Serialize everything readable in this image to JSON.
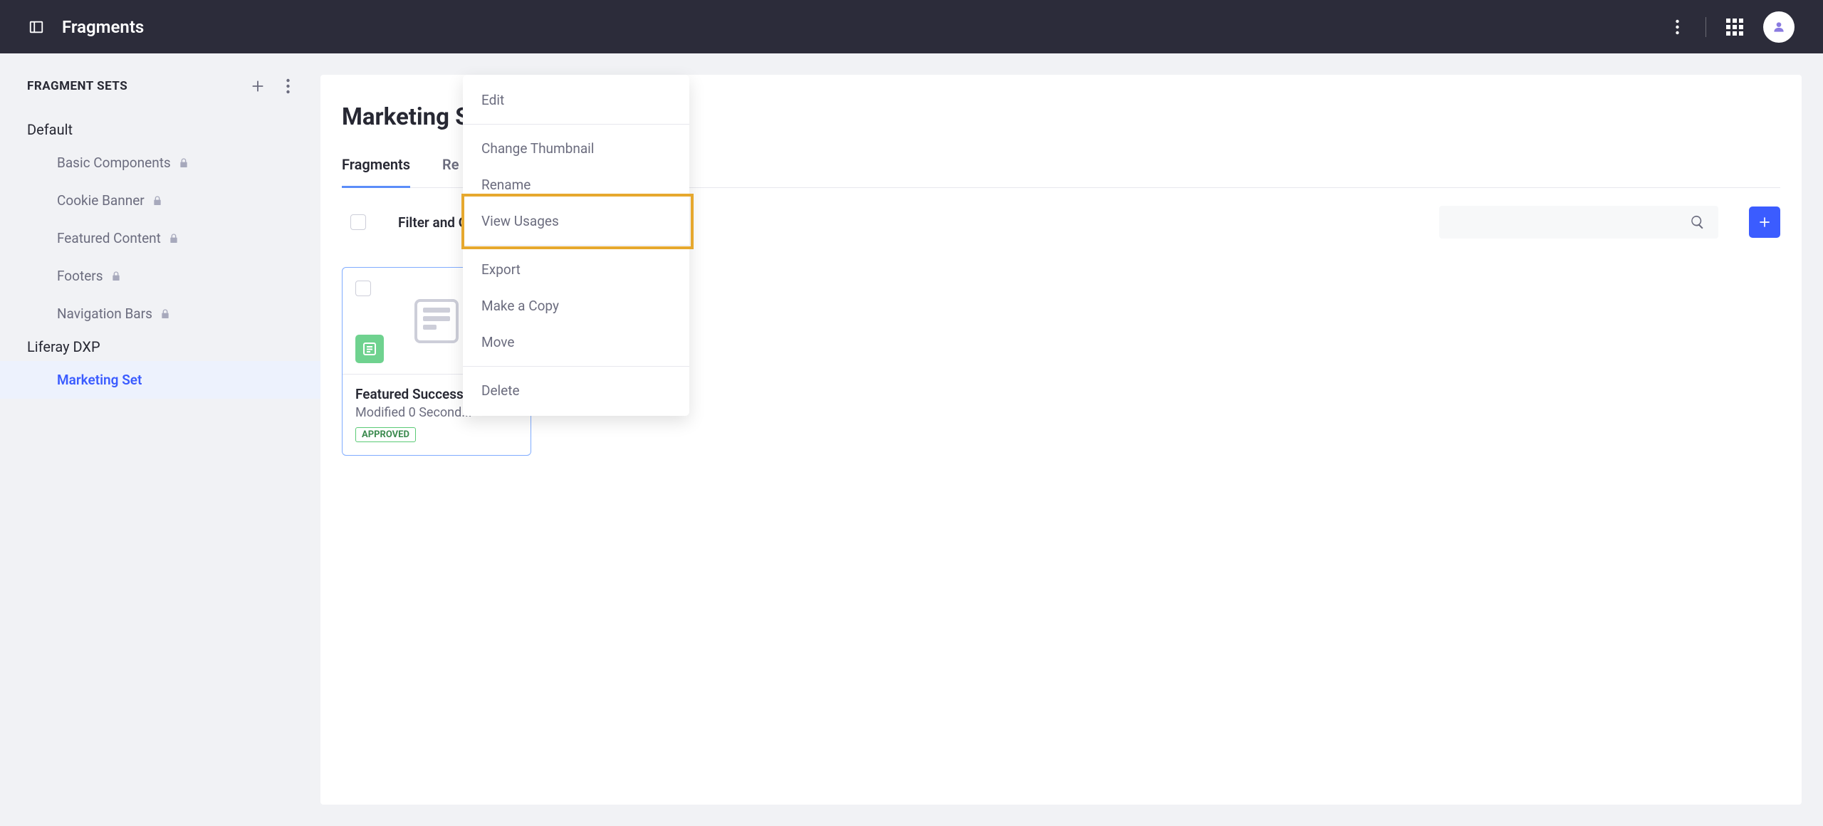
{
  "header": {
    "title": "Fragments"
  },
  "sidebar": {
    "title": "FRAGMENT SETS",
    "groups": [
      {
        "label": "Default",
        "items": [
          {
            "label": "Basic Components",
            "locked": true
          },
          {
            "label": "Cookie Banner",
            "locked": true
          },
          {
            "label": "Featured Content",
            "locked": true
          },
          {
            "label": "Footers",
            "locked": true
          },
          {
            "label": "Navigation Bars",
            "locked": true
          }
        ]
      },
      {
        "label": "Liferay DXP",
        "items": [
          {
            "label": "Marketing Set",
            "locked": false,
            "active": true
          }
        ]
      }
    ]
  },
  "main": {
    "title": "Marketing Set",
    "tabs": [
      {
        "label": "Fragments",
        "active": true
      },
      {
        "label": "Re"
      }
    ],
    "toolbar": {
      "filter_label": "Filter and Ord"
    },
    "card": {
      "title": "Featured Success",
      "subtitle": "Modified 0 Second...",
      "status": "APPROVED"
    }
  },
  "dropdown": {
    "items": [
      {
        "label": "Edit"
      },
      {
        "sep": true
      },
      {
        "label": "Change Thumbnail"
      },
      {
        "label": "Rename"
      },
      {
        "label": "View Usages"
      },
      {
        "sep": true
      },
      {
        "label": "Export"
      },
      {
        "label": "Make a Copy"
      },
      {
        "label": "Move"
      },
      {
        "sep": true
      },
      {
        "label": "Delete"
      }
    ]
  }
}
